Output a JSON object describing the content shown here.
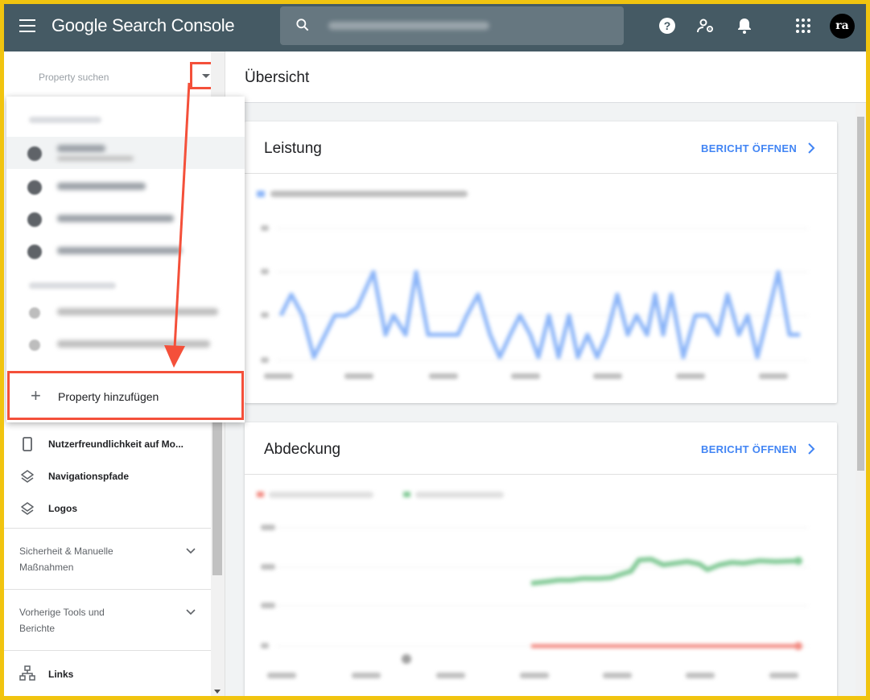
{
  "app": {
    "logo_text": "Google Search Console"
  },
  "search": {
    "placeholder": ""
  },
  "topbar_icons": [
    "help-icon",
    "manage-users-icon",
    "notifications-icon",
    "apps-grid-icon"
  ],
  "avatar": {
    "initials": "ra"
  },
  "sidebar": {
    "property_search_label": "Property suchen",
    "add_property_label": "Property hinzufügen",
    "items": [
      {
        "label": "Nutzerfreundlichkeit auf Mo...",
        "icon": "smartphone-icon"
      },
      {
        "label": "Navigationspfade",
        "icon": "layers-icon"
      },
      {
        "label": "Logos",
        "icon": "layers-icon"
      }
    ],
    "groups": [
      {
        "label_line1": "Sicherheit & Manuelle",
        "label_line2": "Maßnahmen",
        "icon": "chevron-down-icon"
      },
      {
        "label_line1": "Vorherige Tools und",
        "label_line2": "Berichte",
        "icon": "chevron-down-icon"
      }
    ],
    "links_item": {
      "label": "Links",
      "icon": "sitemap-icon"
    }
  },
  "main": {
    "page_title": "Übersicht",
    "cards": [
      {
        "title": "Leistung",
        "link_label": "BERICHT ÖFFNEN"
      },
      {
        "title": "Abdeckung",
        "link_label": "BERICHT ÖFFNEN"
      }
    ]
  },
  "colors": {
    "topbar": "#455a64",
    "annotation": "#f4503a",
    "frame": "#f1c40f",
    "link": "#4285f4",
    "chart_clicks": "#8ab4f8",
    "chart_valid": "#81c995",
    "chart_errors": "#f28b82"
  }
}
